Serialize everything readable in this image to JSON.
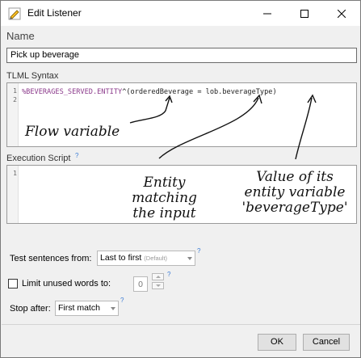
{
  "window": {
    "title": "Edit Listener"
  },
  "name_section": {
    "label": "Name",
    "value": "Pick up beverage"
  },
  "tlml": {
    "label": "TLML Syntax",
    "line_numbers": [
      "1",
      "2"
    ],
    "code_var": "%BEVERAGES_SERVED.ENTITY",
    "code_rest": "^(orderedBeverage = lob.beverageType)"
  },
  "exec": {
    "label": "Execution Script",
    "help": "?",
    "line_numbers": [
      "1"
    ]
  },
  "annotations": {
    "flow_variable": "Flow variable",
    "entity_matching": [
      "Entity",
      "matching",
      "the input"
    ],
    "value_of_entity": [
      "Value of its",
      "entity variable",
      "'beverageType'"
    ]
  },
  "options": {
    "test_sentences_label": "Test sentences from:",
    "test_sentences_value": "Last to first",
    "test_sentences_hint": "(Default)",
    "limit_label": "Limit unused words to:",
    "limit_value": "0",
    "stop_after_label": "Stop after:",
    "stop_after_value": "First match",
    "help": "?"
  },
  "buttons": {
    "ok": "OK",
    "cancel": "Cancel"
  },
  "colors": {
    "title_bar": "#ffffff",
    "dialog_bg": "#f0f0f0",
    "code_variable": "#8b3a8b",
    "help_mark": "#3a7bd5"
  }
}
